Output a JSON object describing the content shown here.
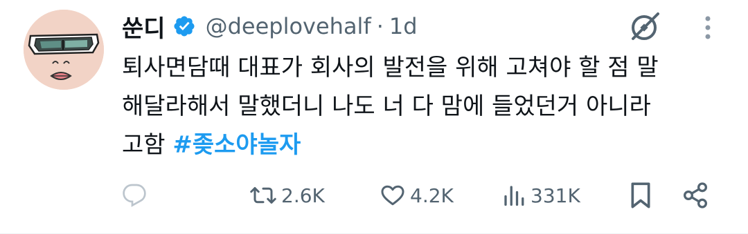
{
  "user": {
    "display_name": "쑨디",
    "handle": "@deeplovehalf",
    "separator": "·",
    "time": "1d"
  },
  "tweet": {
    "lines": [
      "퇴사면담때 대표가 회사의 발전을 위해 고쳐야 할 점 말",
      "해달라해서 말했더니 나도 너 다 맘에 들었던거 아니라"
    ],
    "last_line_text": "고함 ",
    "hashtag": "#좆소야놀자"
  },
  "actions": {
    "reply_count": "",
    "retweet_count": "2.6K",
    "like_count": "4.2K",
    "view_count": "331K"
  },
  "colors": {
    "text": "#0f1419",
    "secondary": "#536471",
    "accent": "#1d9bf0"
  },
  "icons": [
    "verified-badge-icon",
    "grok-icon",
    "more-icon",
    "reply-icon",
    "retweet-icon",
    "like-icon",
    "views-icon",
    "bookmark-icon",
    "share-icon"
  ]
}
